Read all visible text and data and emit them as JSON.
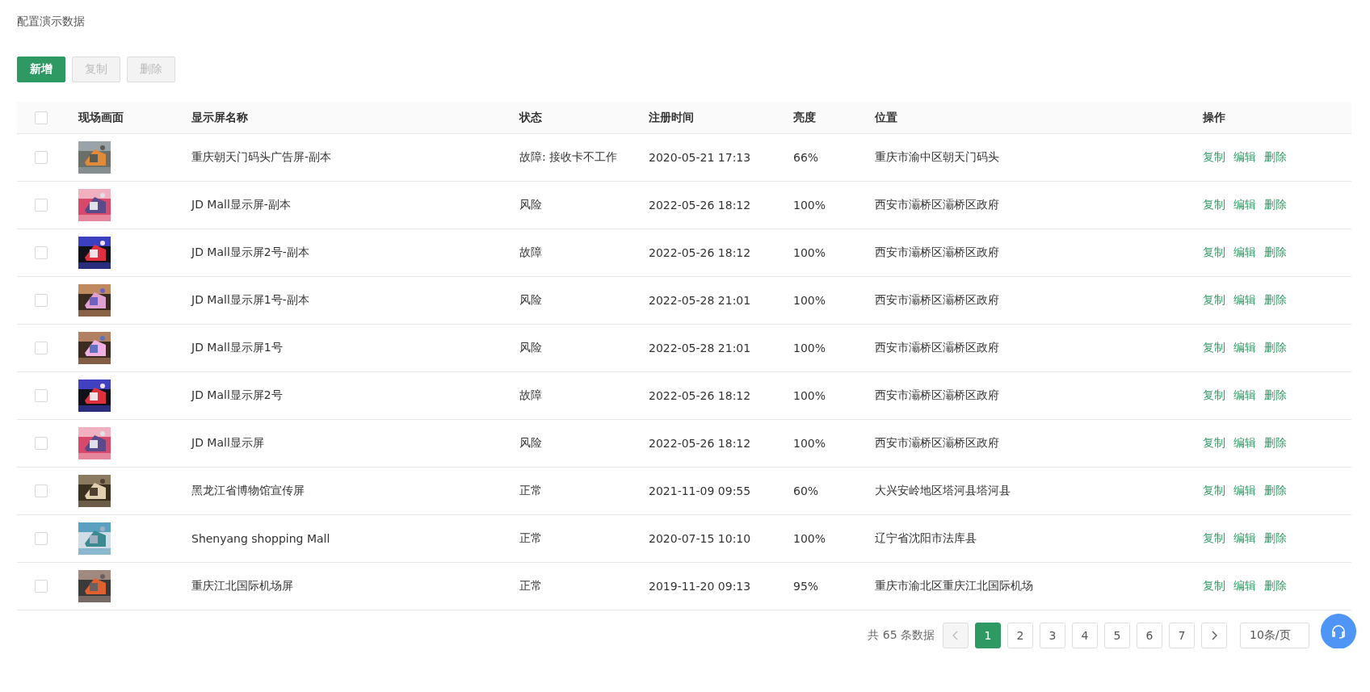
{
  "page_title": "配置演示数据",
  "toolbar": [
    {
      "label": "新增",
      "kind": "primary",
      "disabled": false
    },
    {
      "label": "复制",
      "kind": "default",
      "disabled": true
    },
    {
      "label": "删除",
      "kind": "default",
      "disabled": true
    }
  ],
  "table": {
    "header_checked": false,
    "columns": [
      "现场画面",
      "显示屏名称",
      "状态",
      "注册时间",
      "亮度",
      "位置",
      "操作"
    ],
    "rows": [
      {
        "checked": false,
        "name": "重庆朝天门码头广告屏-副本",
        "status": "故障: 接收卡不工作",
        "registered": "2020-05-21 17:13",
        "brightness": "66%",
        "location": "重庆市渝中区朝天门码头",
        "actions": [
          "复制",
          "编辑",
          "删除"
        ]
      },
      {
        "checked": false,
        "name": "JD Mall显示屏-副本",
        "status": "风险",
        "registered": "2022-05-26 18:12",
        "brightness": "100%",
        "location": "西安市灞桥区灞桥区政府",
        "actions": [
          "复制",
          "编辑",
          "删除"
        ]
      },
      {
        "checked": false,
        "name": "JD Mall显示屏2号-副本",
        "status": "故障",
        "registered": "2022-05-26 18:12",
        "brightness": "100%",
        "location": "西安市灞桥区灞桥区政府",
        "actions": [
          "复制",
          "编辑",
          "删除"
        ]
      },
      {
        "checked": false,
        "name": "JD Mall显示屏1号-副本",
        "status": "风险",
        "registered": "2022-05-28 21:01",
        "brightness": "100%",
        "location": "西安市灞桥区灞桥区政府",
        "actions": [
          "复制",
          "编辑",
          "删除"
        ]
      },
      {
        "checked": false,
        "name": "JD Mall显示屏1号",
        "status": "风险",
        "registered": "2022-05-28 21:01",
        "brightness": "100%",
        "location": "西安市灞桥区灞桥区政府",
        "actions": [
          "复制",
          "编辑",
          "删除"
        ]
      },
      {
        "checked": false,
        "name": "JD Mall显示屏2号",
        "status": "故障",
        "registered": "2022-05-26 18:12",
        "brightness": "100%",
        "location": "西安市灞桥区灞桥区政府",
        "actions": [
          "复制",
          "编辑",
          "删除"
        ]
      },
      {
        "checked": false,
        "name": "JD Mall显示屏",
        "status": "风险",
        "registered": "2022-05-26 18:12",
        "brightness": "100%",
        "location": "西安市灞桥区灞桥区政府",
        "actions": [
          "复制",
          "编辑",
          "删除"
        ]
      },
      {
        "checked": false,
        "name": "黑龙江省博物馆宣传屏",
        "status": "正常",
        "registered": "2021-11-09 09:55",
        "brightness": "60%",
        "location": "大兴安岭地区塔河县塔河县",
        "actions": [
          "复制",
          "编辑",
          "删除"
        ]
      },
      {
        "checked": false,
        "name": "Shenyang shopping Mall",
        "status": "正常",
        "registered": "2020-07-15 10:10",
        "brightness": "100%",
        "location": "辽宁省沈阳市法库县",
        "actions": [
          "复制",
          "编辑",
          "删除"
        ]
      },
      {
        "checked": false,
        "name": "重庆江北国际机场屏",
        "status": "正常",
        "registered": "2019-11-20 09:13",
        "brightness": "95%",
        "location": "重庆市渝北区重庆江北国际机场",
        "actions": [
          "复制",
          "编辑",
          "删除"
        ]
      }
    ]
  },
  "pagination": {
    "total": "共 65 条数据",
    "prev_disabled": true,
    "next_disabled": false,
    "pages": [
      {
        "label": "1",
        "selected": true
      },
      {
        "label": "2",
        "selected": false
      },
      {
        "label": "3",
        "selected": false
      },
      {
        "label": "4",
        "selected": false
      },
      {
        "label": "5",
        "selected": false
      },
      {
        "label": "6",
        "selected": false
      },
      {
        "label": "7",
        "selected": false
      }
    ],
    "page_size": "10条/页"
  }
}
